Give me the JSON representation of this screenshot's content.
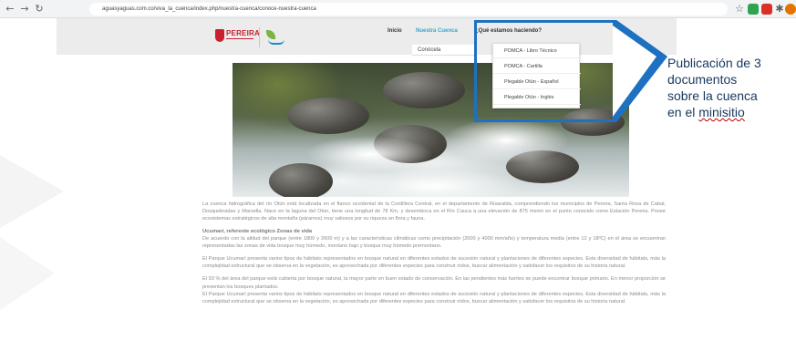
{
  "browser": {
    "url": "aguasyaguas.com.co/viva_la_cuenca/index.php/nuestra-cuenca/conoce-nuestra-cuenca"
  },
  "header": {
    "logo_text": "PEREIRA",
    "nav": [
      {
        "label": "Inicio",
        "active": false
      },
      {
        "label": "Nuestra Cuenca",
        "active": true
      },
      {
        "label": "¿Qué estamos haciendo?",
        "active": false
      }
    ],
    "submenu_item": "Conócela"
  },
  "dropdown": {
    "items": [
      "POMCA - Libro Técnico",
      "POMCA - Cartilla",
      "Plegable Otún - Español",
      "Plegable Otún - Inglés"
    ]
  },
  "callout": {
    "line1": "Publicación de 3",
    "line2": "documentos",
    "line3": "sobre la cuenca",
    "line4_prefix": "en el",
    "line4_word": "minisitio",
    "color": "#1e71c1"
  },
  "content": {
    "p1": "La cuenca hidrográfica del río Otún está localizada en el flanco occidental de la Cordillera Central, en el departamento de Risaralda, comprendiendo los municipios de Pereira, Santa Rosa de Cabal, Dosquebradas y Marsella. Nace en la laguna del Otún, tiene una longitud de 78 Km, y desemboca en el Río Cauca a una elevación de 875 msnm en el punto conocido como Estación Pereira. Posee ecosistemas estratégicos de alta montaña (páramos) muy valiosos por su riqueza en flora y fauna.",
    "h2": "Ucumarí, referente ecológico Zonas de vida",
    "p2": "De acuerdo con la altitud del parque (entre 1800 y 2600 m) y a las características climáticas como precipitación (2000 y 4000 mm/año) y temperatura media (entre 12 y 18ºC) en el área se encuentran representadas las zonas de vida bosque muy húmedo, montano bajo y bosque muy húmedo premontano.",
    "p3": "El Parque Ucumarí presenta varios tipos de hábitats representados en bosque natural en diferentes estados de sucesión natural y plantaciones de diferentes especies. Esta diversidad de hábitats, más la complejidad estructural que se observa en la vegetación, es aprovechada por diferentes especies para construir nidos, buscar alimentación y satisfacer los requisitos de su historia natural.",
    "p4": "El 93 % del área del parque está cubierta por bosque natural, la mayor parte en buen estado de conservación. En las pendientes más fuertes se puede encontrar bosque primario. En menor proporción se presentan los bosques plantados.",
    "p5": "El Parque Ucumarí presenta varios tipos de hábitats representados en bosque natural en diferentes estados de sucesión natural y plantaciones de diferentes especies. Esta diversidad de hábitats, más la complejidad estructural que se observa en la vegetación, es aprovechada por diferentes especies para construir nidos, buscar alimentación y satisfacer los requisitos de su historia natural."
  }
}
